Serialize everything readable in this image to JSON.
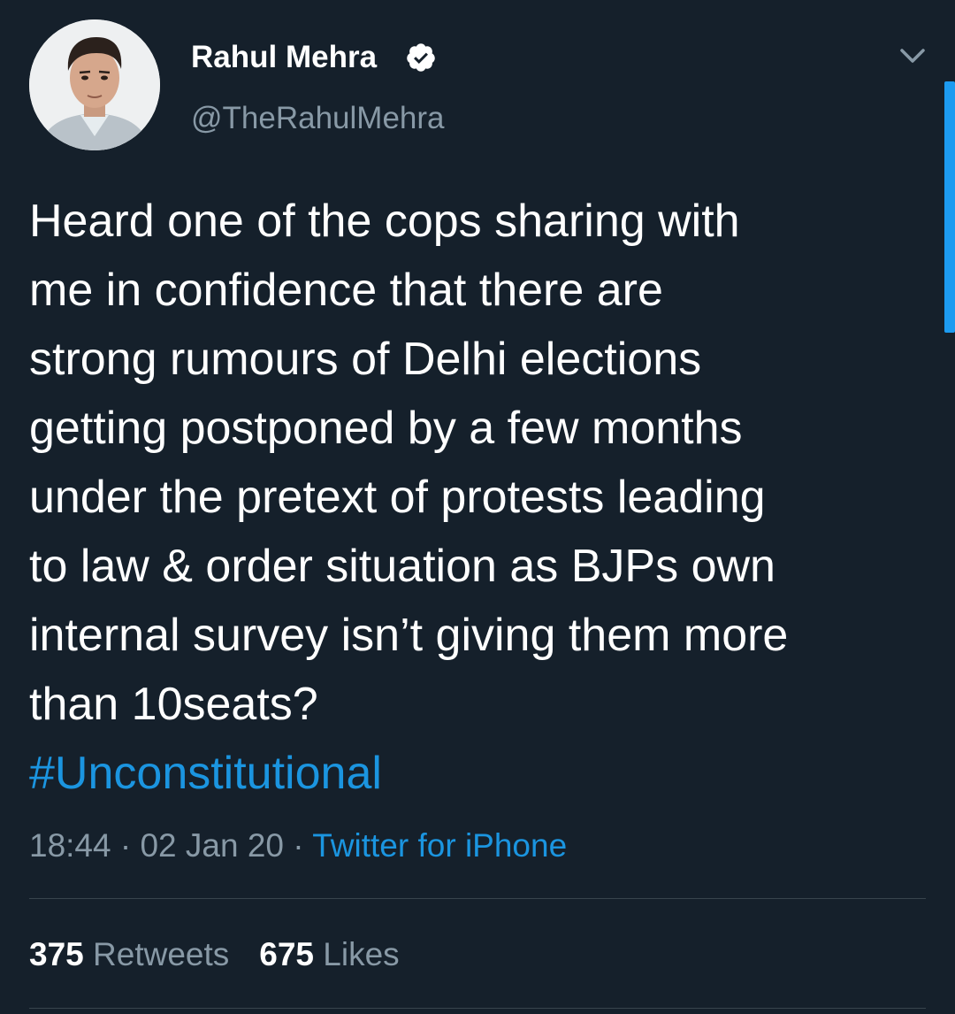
{
  "user": {
    "display_name": "Rahul Mehra",
    "handle": "@TheRahulMehra",
    "verified": true
  },
  "tweet": {
    "text_lines": [
      "Heard one of the cops sharing with",
      "me in confidence that there are",
      "strong rumours of Delhi elections",
      "getting postponed by a few months",
      "under the pretext of protests leading",
      "to law & order situation as BJPs own",
      "internal survey isn’t giving them more",
      "than 10seats?"
    ],
    "hashtag": "#Unconstitutional",
    "time": "18:44",
    "date": "02 Jan 20",
    "separator": "·",
    "source": "Twitter for iPhone"
  },
  "stats": {
    "retweets_count": "375",
    "retweets_label": "Retweets",
    "likes_count": "675",
    "likes_label": "Likes"
  },
  "icons": {
    "verified": "verified-badge-icon",
    "menu": "chevron-down-icon"
  },
  "colors": {
    "background": "#15202b",
    "text": "#ffffff",
    "secondary_text": "#8899a6",
    "accent": "#1b95e0",
    "divider": "#38444d"
  }
}
